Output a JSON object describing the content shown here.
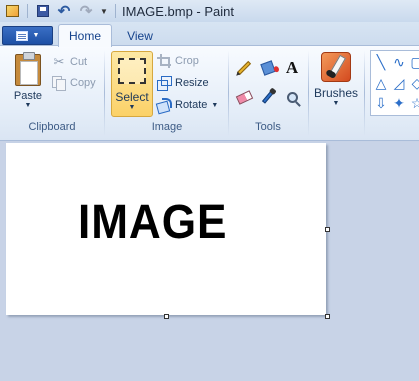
{
  "window": {
    "title": "IMAGE.bmp - Paint"
  },
  "quick_access": {
    "save": "save-icon",
    "undo": "undo-icon",
    "redo": "redo-icon",
    "customize": "chevron-down-icon"
  },
  "tabs": [
    {
      "label": "Home",
      "active": true
    },
    {
      "label": "View",
      "active": false
    }
  ],
  "ribbon": {
    "clipboard": {
      "label": "Clipboard",
      "paste": "Paste",
      "cut": "Cut",
      "copy": "Copy"
    },
    "image": {
      "label": "Image",
      "select": "Select",
      "crop": "Crop",
      "resize": "Resize",
      "rotate": "Rotate"
    },
    "tools": {
      "label": "Tools",
      "items": [
        "pencil-icon",
        "fill-icon",
        "text-icon",
        "eraser-icon",
        "color-picker-icon",
        "magnifier-icon"
      ],
      "text_glyph": "A"
    },
    "brushes": {
      "label": "Brushes"
    },
    "shapes": {
      "glyphs": [
        "╲",
        "∿",
        "▢",
        "△",
        "◿",
        "◇",
        "⇩",
        "✦",
        "☆"
      ]
    }
  },
  "canvas": {
    "text": "IMAGE",
    "background": "#ffffff"
  },
  "colors": {
    "ribbon_bg": "#f8fbff",
    "select_active": "#fbd168",
    "workspace": "#c8d3e7",
    "file_button": "#1d4fa5"
  }
}
